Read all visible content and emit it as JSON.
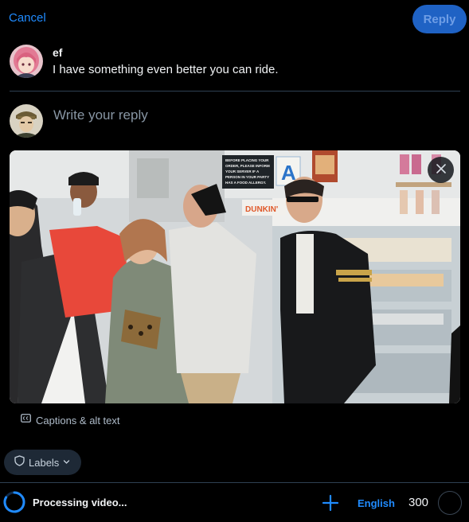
{
  "header": {
    "cancel_label": "Cancel",
    "reply_label": "Reply"
  },
  "parent_post": {
    "author": "ef",
    "text": "I have something even better you can ride."
  },
  "composer": {
    "placeholder": "Write your reply"
  },
  "media": {
    "sign_text": [
      "BEFORE PLACING YOUR",
      "ORDER, PLEASE INFORM",
      "YOUR SERVER IF A",
      "PERSON IN YOUR PARTY",
      "HAS A FOOD ALLERGY."
    ],
    "grade_letter": "A",
    "store_sign": "DUNKIN'"
  },
  "captions": {
    "label": "Captions & alt text"
  },
  "labels": {
    "label": "Labels"
  },
  "footer": {
    "status": "Processing video...",
    "language": "English",
    "char_count": "300"
  },
  "colors": {
    "accent": "#208bfe",
    "reply_button": "#1f62c4",
    "divider": "#2e4052"
  },
  "icons": [
    "close-icon",
    "cc-icon",
    "shield-icon",
    "chevron-down-icon",
    "plus-icon",
    "spinner-icon"
  ]
}
